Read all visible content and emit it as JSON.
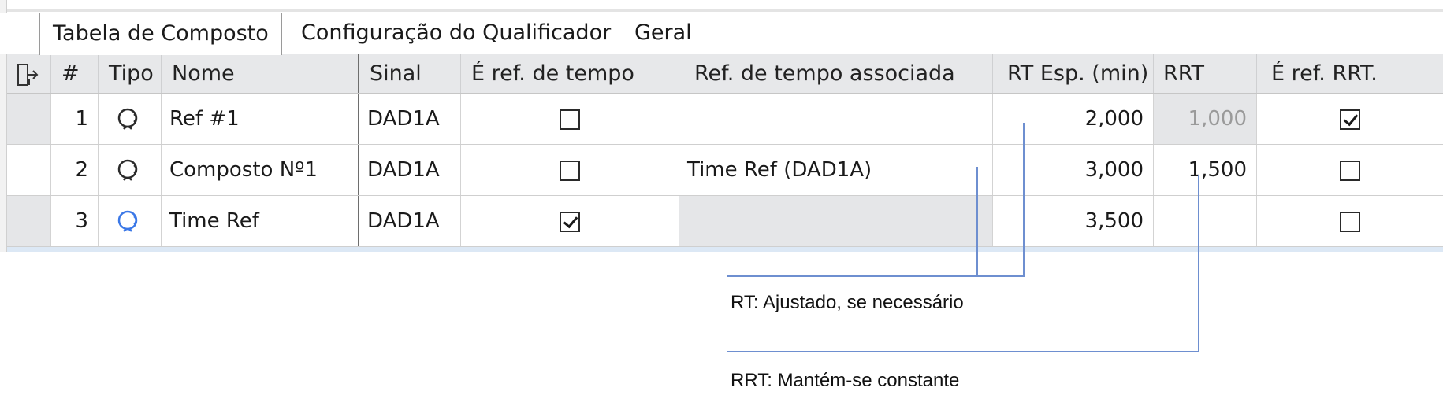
{
  "tabs": [
    {
      "label": "Tabela de Composto",
      "active": true
    },
    {
      "label": "Configuração do Qualificador",
      "active": false
    },
    {
      "label": "Geral",
      "active": false
    }
  ],
  "columns": [
    "#",
    "Tipo",
    "Nome",
    "Sinal",
    "É ref. de tempo",
    "Ref. de tempo associada",
    "RT Esp. (min)",
    "RRT",
    "É ref. RRT."
  ],
  "rows": [
    {
      "num": "1",
      "type_icon": "compound-icon",
      "name": "Ref #1",
      "signal": "DAD1A",
      "is_time_ref": false,
      "assoc_time_ref": "",
      "rt_exp": "2,000",
      "rrt": "1,000",
      "is_rrt_ref": true
    },
    {
      "num": "2",
      "type_icon": "compound-icon",
      "name": "Composto Nº1",
      "signal": "DAD1A",
      "is_time_ref": false,
      "assoc_time_ref": "Time Ref (DAD1A)",
      "rt_exp": "3,000",
      "rrt": "1,500",
      "is_rrt_ref": false
    },
    {
      "num": "3",
      "type_icon": "time-ref-compound-icon",
      "name": "Time Ref",
      "signal": "DAD1A",
      "is_time_ref": true,
      "assoc_time_ref": "",
      "rt_exp": "3,500",
      "rrt": "",
      "is_rrt_ref": false
    }
  ],
  "annotations": {
    "rt_note": "RT: Ajustado, se necessário",
    "rrt_note": "RRT: Mantém-se constante"
  },
  "colors": {
    "accent_line": "#6e8fd0",
    "time_ref_icon": "#3b78e7"
  }
}
